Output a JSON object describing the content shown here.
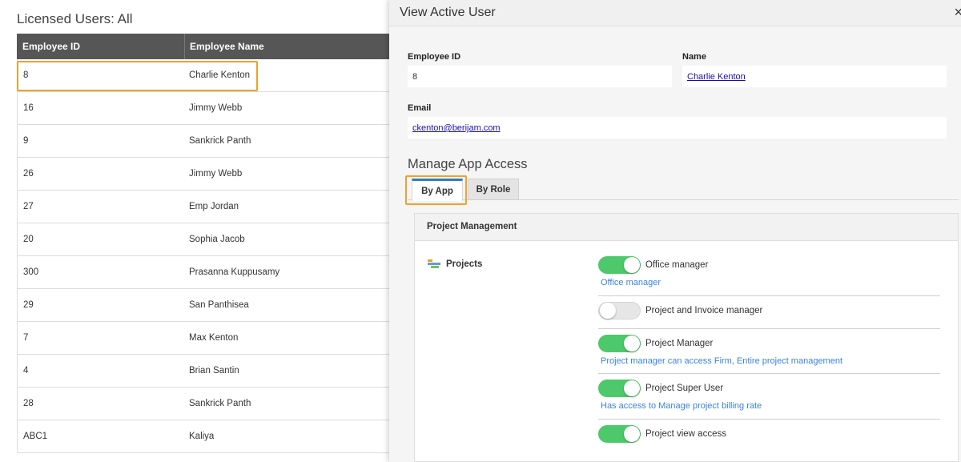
{
  "left": {
    "title": "Licensed Users: All",
    "columns": {
      "id": "Employee ID",
      "name": "Employee Name"
    },
    "rows": [
      {
        "id": "8",
        "name": "Charlie Kenton"
      },
      {
        "id": "16",
        "name": "Jimmy Webb"
      },
      {
        "id": "9",
        "name": "Sankrick Panth"
      },
      {
        "id": "26",
        "name": "Jimmy Webb"
      },
      {
        "id": "27",
        "name": "Emp Jordan"
      },
      {
        "id": "20",
        "name": "Sophia Jacob"
      },
      {
        "id": "300",
        "name": "Prasanna Kuppusamy"
      },
      {
        "id": "29",
        "name": "San Panthisea"
      },
      {
        "id": "7",
        "name": "Max Kenton"
      },
      {
        "id": "4",
        "name": "Brian Santin"
      },
      {
        "id": "28",
        "name": "Sankrick Panth"
      },
      {
        "id": "ABC1",
        "name": "Kaliya"
      }
    ]
  },
  "modal": {
    "title": "View Active User",
    "close_icon": "×",
    "employee_id_label": "Employee ID",
    "employee_id_value": "8",
    "name_label": "Name",
    "name_value": "Charlie Kenton",
    "email_label": "Email",
    "email_value": "ckenton@berijam.com",
    "manage_title": "Manage App Access",
    "tabs": {
      "by_app": "By App",
      "by_role": "By Role"
    },
    "panel_title": "Project Management",
    "app_name": "Projects",
    "permissions": [
      {
        "label": "Office manager",
        "enabled": true,
        "description": "Office manager"
      },
      {
        "label": "Project and Invoice manager",
        "enabled": false,
        "description": ""
      },
      {
        "label": "Project Manager",
        "enabled": true,
        "description": "Project manager can access Firm, Entire project management"
      },
      {
        "label": "Project Super User",
        "enabled": true,
        "description": "Has access to Manage project billing rate"
      },
      {
        "label": "Project view access",
        "enabled": true,
        "description": ""
      }
    ]
  },
  "colors": {
    "toggle_on": "#4dc86a",
    "highlight": "#f0a030",
    "link": "#1a0dab",
    "description": "#3a84d8",
    "table_header": "#565656"
  }
}
